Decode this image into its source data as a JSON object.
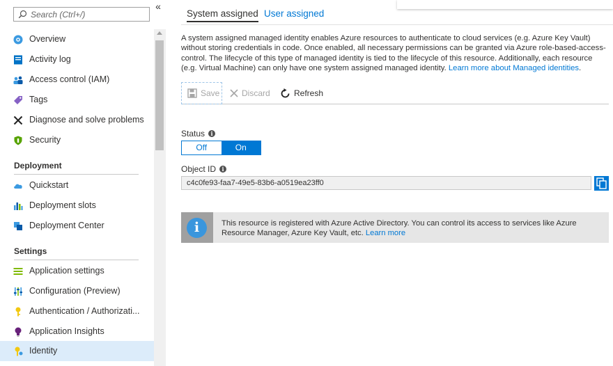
{
  "sidebar": {
    "search": {
      "placeholder": "Search (Ctrl+/)"
    },
    "collapse_glyph": "«",
    "items": [
      {
        "label": "Overview"
      },
      {
        "label": "Activity log"
      },
      {
        "label": "Access control (IAM)"
      },
      {
        "label": "Tags"
      },
      {
        "label": "Diagnose and solve problems"
      },
      {
        "label": "Security"
      }
    ],
    "sections": [
      {
        "heading": "Deployment",
        "items": [
          {
            "label": "Quickstart"
          },
          {
            "label": "Deployment slots"
          },
          {
            "label": "Deployment Center"
          }
        ]
      },
      {
        "heading": "Settings",
        "items": [
          {
            "label": "Application settings"
          },
          {
            "label": "Configuration (Preview)"
          },
          {
            "label": "Authentication / Authorizati..."
          },
          {
            "label": "Application Insights"
          },
          {
            "label": "Identity"
          }
        ]
      }
    ]
  },
  "tabs": [
    {
      "label": "System assigned"
    },
    {
      "label": "User assigned"
    }
  ],
  "description": {
    "text": "A system assigned managed identity enables Azure resources to authenticate to cloud services (e.g. Azure Key Vault) without storing credentials in code. Once enabled, all necessary permissions can be granted via Azure role-based-access-control. The lifecycle of this type of managed identity is tied to the lifecycle of this resource. Additionally, each resource (e.g. Virtual Machine) can only have one system assigned managed identity. ",
    "link": "Learn more about Managed identities",
    "after": "."
  },
  "toolbar": {
    "save_label": "Save",
    "discard_label": "Discard",
    "refresh_label": "Refresh"
  },
  "status": {
    "label": "Status",
    "off_label": "Off",
    "on_label": "On",
    "value": "On"
  },
  "object_id": {
    "label": "Object ID",
    "value": "c4c0fe93-faa7-49e5-83b6-a0519ea23ff0"
  },
  "info_banner": {
    "text": "This resource is registered with Azure Active Directory. You can control its access to services like Azure Resource Manager, Azure Key Vault, etc. ",
    "link": "Learn more"
  },
  "colors": {
    "accent": "#0078d4",
    "selected_bg": "#dcecfa",
    "banner_bg": "#e6e6e6"
  },
  "icons": {
    "overview": "globe-gear-icon",
    "activity_log": "log-book-icon",
    "iam": "people-icon",
    "tags": "tag-icon",
    "diagnose": "wrench-cross-icon",
    "security": "shield-icon",
    "quickstart": "cloud-icon",
    "slots": "bar-slots-icon",
    "center": "cube-icon",
    "app_settings": "list-icon",
    "configuration": "sliders-icon",
    "auth": "key-icon",
    "insights": "lightbulb-icon",
    "identity": "key-yellow-icon"
  }
}
